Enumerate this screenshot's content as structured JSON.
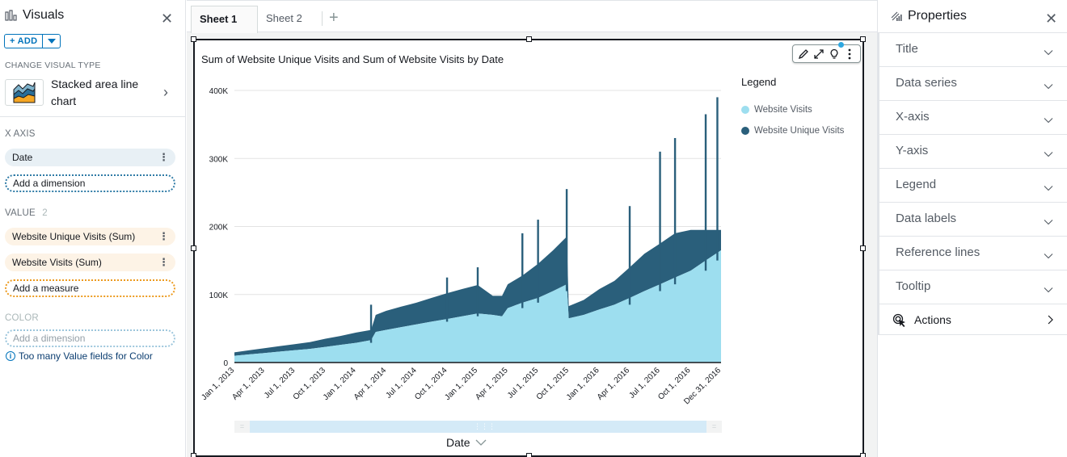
{
  "visuals_panel": {
    "title": "Visuals",
    "add_label": "+ ADD",
    "change_visual_type_label": "CHANGE VISUAL TYPE",
    "visual_type_name": "Stacked area line chart",
    "x_axis_label": "X AXIS",
    "x_axis_field": "Date",
    "x_axis_placeholder": "Add a dimension",
    "value_label": "VALUE",
    "value_count": "2",
    "value_fields": [
      "Website Unique Visits (Sum)",
      "Website Visits (Sum)"
    ],
    "value_placeholder": "Add a measure",
    "color_label": "COLOR",
    "color_placeholder": "Add a dimension",
    "color_info": "Too many Value fields for Color"
  },
  "sheets": {
    "tabs": [
      {
        "label": "Sheet 1",
        "active": true
      },
      {
        "label": "Sheet 2",
        "active": false
      }
    ],
    "add_icon": "plus-icon"
  },
  "visual": {
    "title": "Sum of Website Unique Visits and Sum of Website Visits by Date",
    "toolbar_icons": [
      "pencil-icon",
      "expand-icon",
      "lightbulb-icon",
      "kebab-menu-icon"
    ],
    "legend_title": "Legend",
    "x_axis_title": "Date"
  },
  "colors": {
    "website_visits": "#9ddeef",
    "website_unique_visits": "#2a5f7b",
    "accent": "#0073bb",
    "measure_pill": "#fdf3e6",
    "dimension_pill": "#e8f0f5"
  },
  "chart_data": {
    "type": "area",
    "stacked": true,
    "title": "Sum of Website Unique Visits and Sum of Website Visits by Date",
    "xlabel": "Date",
    "ylabel": "",
    "ylim": [
      0,
      400000
    ],
    "yticks": [
      0,
      100000,
      200000,
      300000,
      400000
    ],
    "ytick_labels": [
      "0",
      "100K",
      "200K",
      "300K",
      "400K"
    ],
    "xtick_labels": [
      "Jan 1, 2013",
      "Apr 1, 2013",
      "Jul 1, 2013",
      "Oct 1, 2013",
      "Jan 1, 2014",
      "Apr 1, 2014",
      "Jul 1, 2014",
      "Oct 1, 2014",
      "Jan 1, 2015",
      "Apr 1, 2015",
      "Jul 1, 2015",
      "Oct 1, 2015",
      "Jan 1, 2016",
      "Apr 1, 2016",
      "Jul 1, 2016",
      "Oct 1, 2016",
      "Dec 31, 2016"
    ],
    "grid": true,
    "legend_position": "top-right",
    "x": [
      "2013-01-01",
      "2013-02-15",
      "2013-04-01",
      "2013-05-15",
      "2013-07-01",
      "2013-08-15",
      "2013-10-01",
      "2013-11-15",
      "2014-01-01",
      "2014-02-15",
      "2014-03-01",
      "2014-04-01",
      "2014-05-15",
      "2014-07-01",
      "2014-08-15",
      "2014-10-01",
      "2014-11-15",
      "2015-01-01",
      "2015-02-15",
      "2015-03-15",
      "2015-04-01",
      "2015-05-15",
      "2015-07-01",
      "2015-08-15",
      "2015-09-25",
      "2015-10-01",
      "2015-11-15",
      "2016-01-01",
      "2016-02-15",
      "2016-04-01",
      "2016-05-15",
      "2016-07-01",
      "2016-08-15",
      "2016-10-01",
      "2016-11-15",
      "2016-12-31"
    ],
    "series": [
      {
        "name": "Website Visits",
        "values": [
          10000,
          12000,
          14000,
          16000,
          18000,
          20000,
          23000,
          26000,
          29000,
          33000,
          45000,
          48000,
          52000,
          56000,
          60000,
          64000,
          68000,
          72000,
          70000,
          68000,
          80000,
          88000,
          95000,
          105000,
          115000,
          65000,
          70000,
          78000,
          85000,
          95000,
          105000,
          115000,
          125000,
          135000,
          150000,
          165000
        ]
      },
      {
        "name": "Website Unique Visits",
        "values": [
          5000,
          6000,
          7000,
          8000,
          9000,
          10000,
          12000,
          13000,
          15000,
          15000,
          25000,
          28000,
          30000,
          32000,
          35000,
          38000,
          40000,
          42000,
          28000,
          30000,
          35000,
          40000,
          50000,
          60000,
          70000,
          18000,
          22000,
          30000,
          35000,
          45000,
          55000,
          60000,
          65000,
          60000,
          45000,
          30000
        ]
      }
    ],
    "peak_spikes_total": [
      {
        "date": "2014-02-15",
        "value": 85000
      },
      {
        "date": "2014-10-01",
        "value": 125000
      },
      {
        "date": "2015-01-01",
        "value": 140000
      },
      {
        "date": "2015-05-15",
        "value": 190000
      },
      {
        "date": "2015-07-01",
        "value": 210000
      },
      {
        "date": "2015-09-25",
        "value": 255000
      },
      {
        "date": "2016-04-01",
        "value": 230000
      },
      {
        "date": "2016-07-01",
        "value": 310000
      },
      {
        "date": "2016-08-15",
        "value": 330000
      },
      {
        "date": "2016-11-15",
        "value": 365000
      },
      {
        "date": "2016-12-20",
        "value": 390000
      }
    ]
  },
  "properties_panel": {
    "title": "Properties",
    "sections": [
      "Title",
      "Data series",
      "X-axis",
      "Y-axis",
      "Legend",
      "Data labels",
      "Reference lines",
      "Tooltip"
    ],
    "actions_label": "Actions"
  }
}
